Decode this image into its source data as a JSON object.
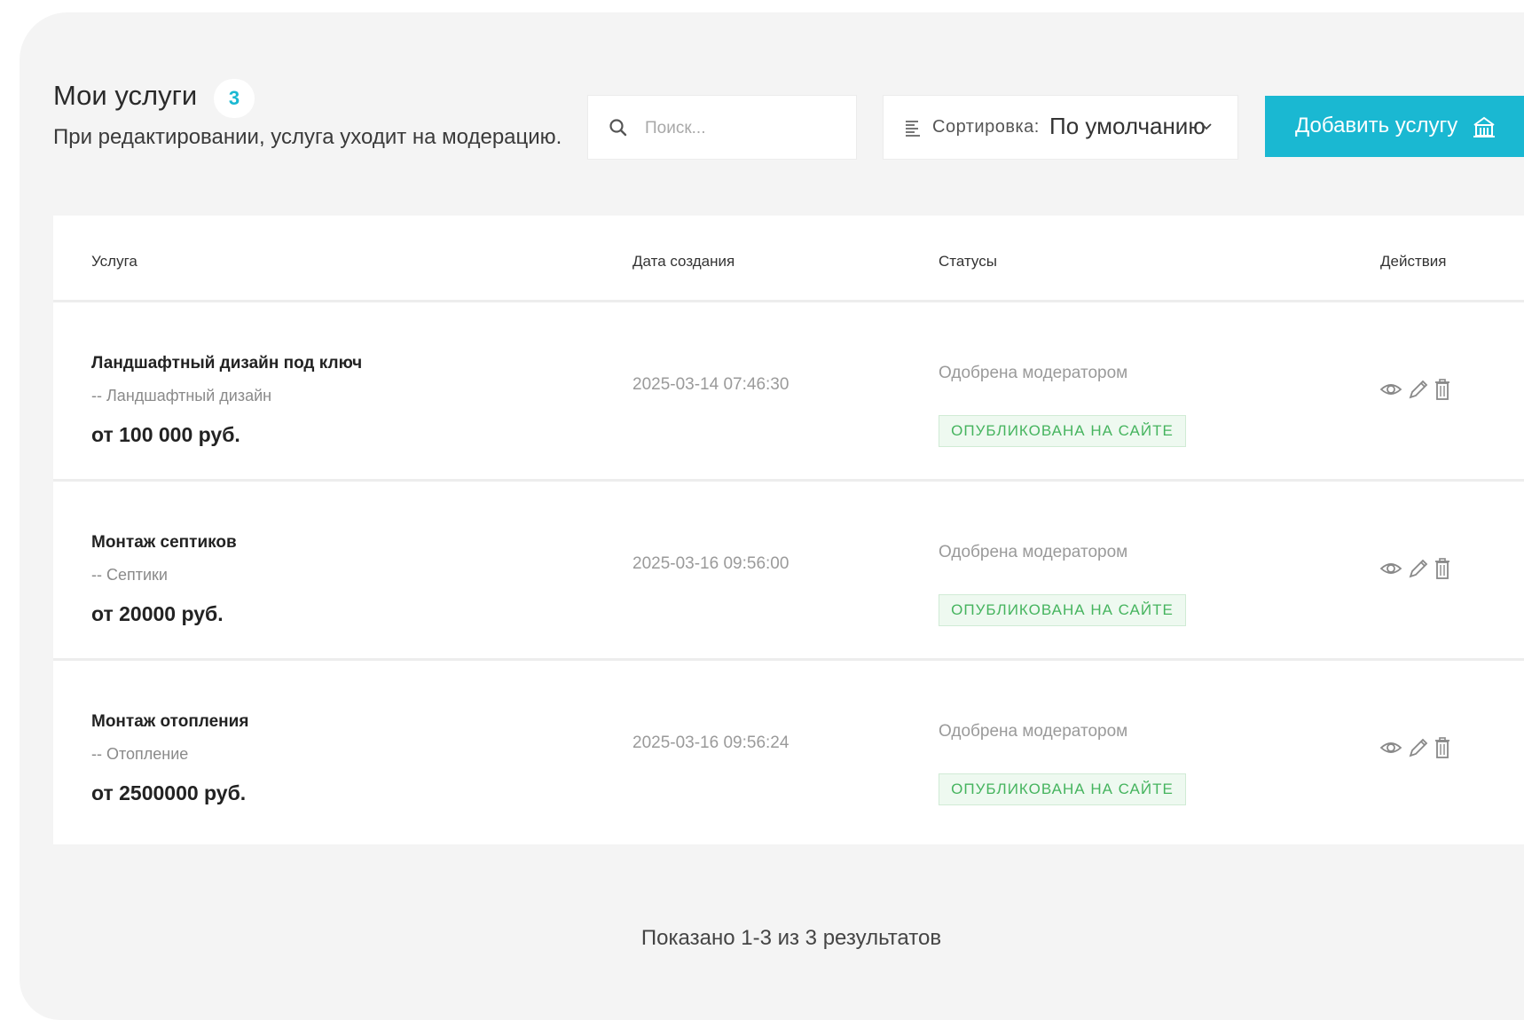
{
  "header": {
    "title": "Мои услуги",
    "count": "3",
    "subtitle": "При редактировании, услуга уходит на модерацию."
  },
  "search": {
    "placeholder": "Поиск...",
    "value": ""
  },
  "sort": {
    "label": "Сортировка:",
    "value": "По умолчанию"
  },
  "add_button": {
    "label": "Добавить услугу"
  },
  "table": {
    "headers": {
      "service": "Услуга",
      "date": "Дата создания",
      "status": "Статусы",
      "actions": "Действия"
    },
    "rows": [
      {
        "name": "Ландшафтный дизайн под ключ",
        "category": "-- Ландшафтный дизайн",
        "price": "от 100 000 руб.",
        "date": "2025-03-14 07:46:30",
        "status": "Одобрена модератором",
        "badge": "ОПУБЛИКОВАНА НА САЙТЕ"
      },
      {
        "name": "Монтаж септиков",
        "category": "-- Септики",
        "price": "от 20000 руб.",
        "date": "2025-03-16 09:56:00",
        "status": "Одобрена модератором",
        "badge": "ОПУБЛИКОВАНА НА САЙТЕ"
      },
      {
        "name": "Монтаж отопления",
        "category": "-- Отопление",
        "price": "от 2500000 руб.",
        "date": "2025-03-16 09:56:24",
        "status": "Одобрена модератором",
        "badge": "ОПУБЛИКОВАНА НА САЙТЕ"
      }
    ]
  },
  "pagination": {
    "summary": "Показано 1-3 из 3 результатов"
  },
  "icons": {
    "search": "search-icon",
    "sort": "sort-lines-icon",
    "chevron": "chevron-down-icon",
    "add": "building-icon",
    "view": "eye-icon",
    "edit": "pencil-icon",
    "delete": "trash-icon"
  },
  "colors": {
    "accent": "#1ab8d2",
    "published_text": "#45b45e",
    "published_bg": "#eef9f0",
    "card_bg": "#f4f4f4"
  }
}
